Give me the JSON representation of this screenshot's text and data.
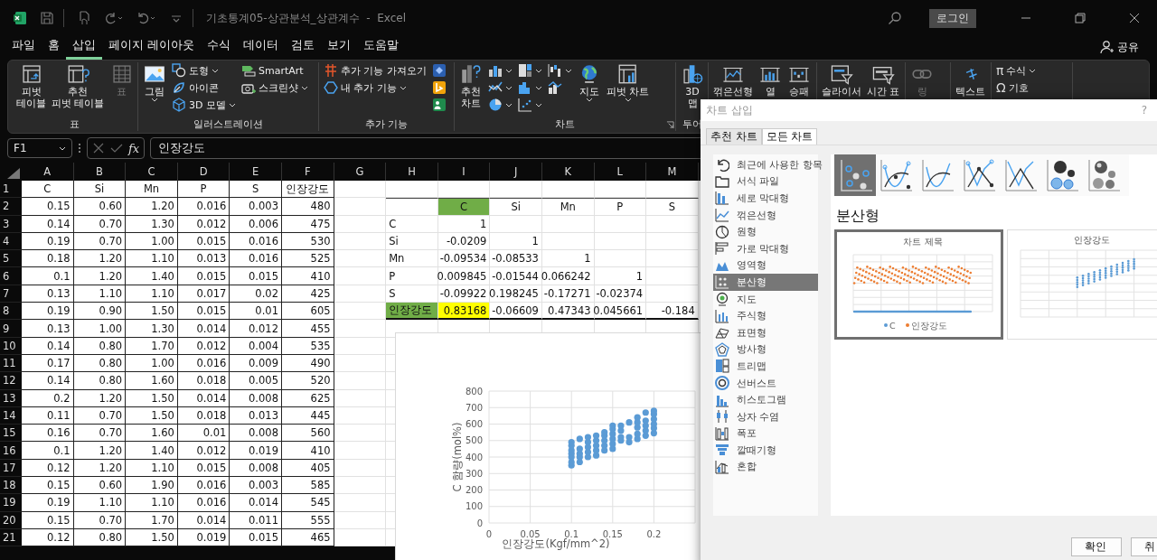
{
  "title_bar": {
    "document_title": "기초통계05-상관분석_상관계수",
    "separator": "-",
    "app_name": "Excel",
    "sign_in": "로그인"
  },
  "menu": {
    "tabs": [
      {
        "label": "파일",
        "selected": false
      },
      {
        "label": "홈",
        "selected": false
      },
      {
        "label": "삽입",
        "selected": true
      },
      {
        "label": "페이지 레이아웃",
        "selected": false
      },
      {
        "label": "수식",
        "selected": false
      },
      {
        "label": "데이터",
        "selected": false
      },
      {
        "label": "검토",
        "selected": false
      },
      {
        "label": "보기",
        "selected": false
      },
      {
        "label": "도움말",
        "selected": false
      }
    ],
    "share": "공유"
  },
  "ribbon": {
    "groups": [
      {
        "label": "표",
        "sections": [
          {
            "kind": "large",
            "lines": [
              "피벗",
              "테이블"
            ],
            "disabled": false,
            "menu": false
          },
          {
            "kind": "large",
            "lines": [
              "추천",
              "피벗 테이블"
            ],
            "disabled": false,
            "menu": false
          },
          {
            "kind": "large",
            "lines": [
              "표"
            ],
            "disabled": true,
            "menu": false
          }
        ]
      },
      {
        "label": "일러스트레이션",
        "sections": [
          {
            "kind": "large",
            "lines": [
              "그림"
            ],
            "disabled": false,
            "menu": true
          },
          {
            "kind": "stack",
            "items": [
              {
                "label": "도형",
                "menu": true
              },
              {
                "label": "아이콘",
                "menu": false
              },
              {
                "label": "3D 모델",
                "menu": true
              }
            ]
          },
          {
            "kind": "stack",
            "items": [
              {
                "label": "SmartArt",
                "menu": false
              },
              {
                "label": "스크린샷",
                "menu": true
              }
            ]
          }
        ]
      },
      {
        "label": "추가 기능",
        "sections": [
          {
            "kind": "stack",
            "items": [
              {
                "label": "추가 기능 가져오기",
                "menu": false
              },
              {
                "label": "내 추가 기능",
                "menu": true
              }
            ]
          },
          {
            "kind": "stack",
            "items": [
              {
                "menu": false
              },
              {
                "menu": false
              },
              {
                "menu": false
              }
            ]
          }
        ]
      },
      {
        "label": "차트",
        "launcher": true,
        "sections": [
          {
            "kind": "large",
            "lines": [
              "추천",
              "차트"
            ],
            "disabled": false,
            "menu": false
          },
          {
            "kind": "stack",
            "items": [
              {
                "menu": true
              },
              {
                "menu": true
              },
              {
                "menu": true
              }
            ]
          },
          {
            "kind": "stack",
            "items": [
              {
                "menu": true
              },
              {
                "menu": true
              },
              {
                "menu": true
              }
            ]
          },
          {
            "kind": "stack",
            "items": [
              {
                "menu": true
              },
              {
                "menu": false
              }
            ]
          },
          {
            "kind": "large",
            "lines": [
              "지도"
            ],
            "disabled": false,
            "menu": true
          },
          {
            "kind": "large",
            "lines": [
              "피벗 차트"
            ],
            "disabled": false,
            "menu": true
          }
        ]
      },
      {
        "label": "투어",
        "sections": [
          {
            "kind": "large",
            "lines": [
              "3D",
              "맵"
            ],
            "disabled": false,
            "menu": false
          }
        ]
      },
      {
        "sections": [
          {
            "kind": "large",
            "lines": [
              "꺾은선형"
            ],
            "disabled": false,
            "menu": false
          },
          {
            "kind": "large",
            "lines": [
              "열"
            ],
            "disabled": false,
            "menu": false
          },
          {
            "kind": "large",
            "lines": [
              "승패"
            ],
            "disabled": false,
            "menu": false
          }
        ]
      },
      {
        "sections": [
          {
            "kind": "large",
            "lines": [
              "슬라이서"
            ],
            "disabled": false,
            "menu": false
          },
          {
            "kind": "large",
            "lines": [
              "시간 표"
            ],
            "disabled": false,
            "menu": false
          }
        ]
      },
      {
        "sections": [
          {
            "kind": "large",
            "lines": [
              "링"
            ],
            "disabled": true,
            "menu": false
          }
        ]
      },
      {
        "sections": [
          {
            "kind": "large",
            "lines": [
              "텍스트"
            ],
            "disabled": false,
            "menu": false
          }
        ]
      },
      {
        "sections": [
          {
            "kind": "stack",
            "items": [
              {
                "glyph": "π",
                "label": "수식",
                "menu": true
              },
              {
                "glyph": "Ω",
                "label": "기호",
                "menu": false
              }
            ]
          }
        ]
      }
    ]
  },
  "formula_bar": {
    "name_box": "F1",
    "fx": "fx",
    "formula": "인장강도"
  },
  "sheet": {
    "columns": [
      "A",
      "B",
      "C",
      "D",
      "E",
      "F",
      "G",
      "H",
      "I",
      "J",
      "K",
      "L",
      "M"
    ],
    "row_numbers": [
      "1",
      "2",
      "3",
      "4",
      "5",
      "6",
      "7",
      "8",
      "9",
      "10",
      "11",
      "12",
      "13",
      "14",
      "15",
      "16",
      "17",
      "18",
      "19",
      "20",
      "21"
    ],
    "data_table": {
      "header": [
        "C",
        "Si",
        "Mn",
        "P",
        "S",
        "인장강도"
      ],
      "rows": [
        [
          "0.15",
          "0.60",
          "1.20",
          "0.016",
          "0.003",
          "480"
        ],
        [
          "0.14",
          "0.70",
          "1.30",
          "0.012",
          "0.006",
          "475"
        ],
        [
          "0.19",
          "0.70",
          "1.00",
          "0.015",
          "0.016",
          "530"
        ],
        [
          "0.18",
          "1.20",
          "1.10",
          "0.013",
          "0.016",
          "525"
        ],
        [
          "0.1",
          "1.20",
          "1.40",
          "0.015",
          "0.015",
          "410"
        ],
        [
          "0.13",
          "1.10",
          "1.10",
          "0.017",
          "0.02",
          "425"
        ],
        [
          "0.19",
          "0.90",
          "1.50",
          "0.015",
          "0.01",
          "605"
        ],
        [
          "0.13",
          "1.00",
          "1.30",
          "0.014",
          "0.012",
          "455"
        ],
        [
          "0.14",
          "0.80",
          "1.70",
          "0.012",
          "0.004",
          "535"
        ],
        [
          "0.17",
          "0.80",
          "1.00",
          "0.016",
          "0.009",
          "490"
        ],
        [
          "0.14",
          "0.80",
          "1.60",
          "0.018",
          "0.005",
          "520"
        ],
        [
          "0.2",
          "1.20",
          "1.50",
          "0.014",
          "0.008",
          "625"
        ],
        [
          "0.11",
          "0.70",
          "1.50",
          "0.018",
          "0.013",
          "445"
        ],
        [
          "0.16",
          "0.70",
          "1.60",
          "0.01",
          "0.008",
          "560"
        ],
        [
          "0.1",
          "1.20",
          "1.40",
          "0.012",
          "0.019",
          "410"
        ],
        [
          "0.12",
          "1.20",
          "1.10",
          "0.015",
          "0.008",
          "405"
        ],
        [
          "0.15",
          "0.60",
          "1.90",
          "0.016",
          "0.003",
          "585"
        ],
        [
          "0.19",
          "1.10",
          "1.10",
          "0.016",
          "0.014",
          "545"
        ],
        [
          "0.15",
          "0.70",
          "1.70",
          "0.014",
          "0.011",
          "555"
        ],
        [
          "0.12",
          "0.80",
          "1.50",
          "0.019",
          "0.015",
          "465"
        ]
      ]
    },
    "correlation": {
      "columns": [
        {
          "text": "C",
          "color": "#70ad47"
        },
        {
          "text": "Si"
        },
        {
          "text": "Mn"
        },
        {
          "text": "P"
        },
        {
          "text": "S"
        }
      ],
      "rows": [
        {
          "label": {
            "text": "C"
          },
          "cells": [
            {
              "text": "1"
            }
          ]
        },
        {
          "label": {
            "text": "Si"
          },
          "cells": [
            {
              "text": "-0.0209"
            },
            {
              "text": "1"
            }
          ]
        },
        {
          "label": {
            "text": "Mn"
          },
          "cells": [
            {
              "text": "-0.09534"
            },
            {
              "text": "-0.08533"
            },
            {
              "text": "1"
            }
          ]
        },
        {
          "label": {
            "text": "P"
          },
          "cells": [
            {
              "text": "0.009845"
            },
            {
              "text": "-0.01544"
            },
            {
              "text": "0.066242"
            },
            {
              "text": "1"
            }
          ]
        },
        {
          "label": {
            "text": "S"
          },
          "cells": [
            {
              "text": "-0.09922"
            },
            {
              "text": "0.198245"
            },
            {
              "text": "-0.17271"
            },
            {
              "text": "-0.02374"
            }
          ]
        },
        {
          "label": {
            "text": "인장강도",
            "color": "#70ad47"
          },
          "cells": [
            {
              "text": "0.83168",
              "color": "#ffff00"
            },
            {
              "text": "-0.06609"
            },
            {
              "text": "0.47343"
            },
            {
              "text": "0.045661"
            },
            {
              "text": "-0.184"
            }
          ]
        }
      ]
    },
    "chart": {
      "chart_data": {
        "type": "scatter",
        "xlabel": "인장강도(Kgf/mm^2)",
        "ylabel": "C 함량(mol%)",
        "grid": true,
        "xlim": [
          0,
          0.25
        ],
        "ylim": [
          0,
          800
        ],
        "xticks": [
          0,
          0.05,
          0.1,
          0.15,
          0.2
        ],
        "yticks": [
          0,
          100,
          200,
          300,
          400,
          500,
          600,
          700,
          800
        ],
        "x": [
          0.1,
          0.1,
          0.1,
          0.1,
          0.1,
          0.1,
          0.1,
          0.11,
          0.11,
          0.11,
          0.11,
          0.11,
          0.12,
          0.12,
          0.12,
          0.12,
          0.12,
          0.13,
          0.13,
          0.13,
          0.13,
          0.13,
          0.14,
          0.14,
          0.14,
          0.14,
          0.14,
          0.15,
          0.15,
          0.15,
          0.15,
          0.15,
          0.15,
          0.16,
          0.16,
          0.16,
          0.16,
          0.17,
          0.17,
          0.17,
          0.18,
          0.18,
          0.18,
          0.18,
          0.18,
          0.19,
          0.19,
          0.19,
          0.19,
          0.19,
          0.2,
          0.2,
          0.2,
          0.2,
          0.2,
          0.2
        ],
        "series": [
          {
            "color": "#5b9bd5",
            "values": [
              350,
              370,
              400,
              420,
              440,
              470,
              490,
              370,
              400,
              420,
              450,
              510,
              400,
              430,
              460,
              490,
              520,
              410,
              440,
              470,
              500,
              530,
              440,
              470,
              500,
              530,
              550,
              450,
              480,
              510,
              540,
              570,
              590,
              500,
              520,
              560,
              590,
              490,
              520,
              610,
              510,
              540,
              580,
              610,
              640,
              530,
              560,
              590,
              620,
              670,
              545,
              575,
              600,
              630,
              660,
              680
            ]
          }
        ]
      }
    }
  },
  "dialog": {
    "title": "차트 삽입",
    "help": "?",
    "tabs": [
      {
        "label": "추천 차트",
        "selected": false
      },
      {
        "label": "모든 차트",
        "selected": true
      }
    ],
    "categories": [
      {
        "label": "최근에 사용한 항목",
        "selected": false
      },
      {
        "label": "서식 파일",
        "selected": false
      },
      {
        "label": "세로 막대형",
        "selected": false
      },
      {
        "label": "꺾은선형",
        "selected": false
      },
      {
        "label": "원형",
        "selected": false
      },
      {
        "label": "가로 막대형",
        "selected": false
      },
      {
        "label": "영역형",
        "selected": false
      },
      {
        "label": "분산형",
        "selected": true
      },
      {
        "label": "지도",
        "selected": false
      },
      {
        "label": "주식형",
        "selected": false
      },
      {
        "label": "표면형",
        "selected": false
      },
      {
        "label": "방사형",
        "selected": false
      },
      {
        "label": "트리맵",
        "selected": false
      },
      {
        "label": "선버스트",
        "selected": false
      },
      {
        "label": "히스토그램",
        "selected": false
      },
      {
        "label": "상자 수염",
        "selected": false
      },
      {
        "label": "폭포",
        "selected": false
      },
      {
        "label": "깔때기형",
        "selected": false
      },
      {
        "label": "혼합",
        "selected": false
      }
    ],
    "subtypes": [
      {
        "selected": true
      },
      {
        "selected": false
      },
      {
        "selected": false
      },
      {
        "selected": false
      },
      {
        "selected": false
      },
      {
        "selected": false
      },
      {
        "selected": false
      }
    ],
    "heading": "분산형",
    "previews": [
      {
        "selected": true,
        "title": "차트 제목",
        "legend": [
          {
            "label": "C",
            "color": "#5b9bd5"
          },
          {
            "label": "인장강도",
            "color": "#ed7d31"
          }
        ]
      },
      {
        "selected": false,
        "title": "인장강도"
      }
    ],
    "buttons": [
      "확인",
      "취"
    ]
  }
}
